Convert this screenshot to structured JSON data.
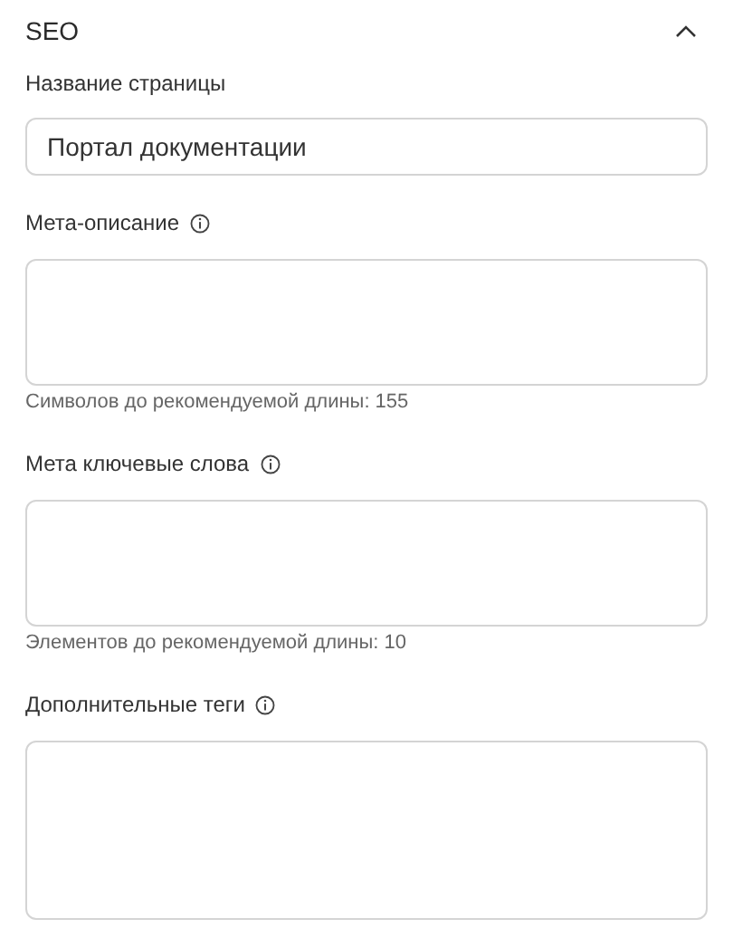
{
  "section": {
    "title": "SEO",
    "expanded": true
  },
  "fields": [
    {
      "kind": "input",
      "label": "Название страницы",
      "info": false,
      "value": "Портал документации"
    },
    {
      "kind": "textarea",
      "label": "Мета-описание",
      "info": true,
      "hint": "Символов до рекомендуемой длины: 155"
    },
    {
      "kind": "textarea",
      "label": "Мета ключевые слова",
      "info": true,
      "hint": "Элементов до рекомендуемой длины: 10"
    },
    {
      "kind": "textarea",
      "label": "Дополнительные теги",
      "info": true
    }
  ]
}
